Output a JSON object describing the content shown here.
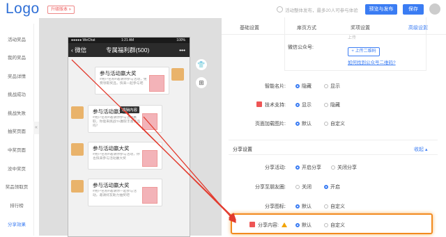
{
  "header": {
    "logo": "Logo",
    "upgrade_label": "升级版本 »",
    "notice": "活动整体发布，最多20人可参与体验",
    "preview_label": "预览与发布",
    "save_label": "保存"
  },
  "sidebar": {
    "items": [
      {
        "label": "活动奖品"
      },
      {
        "label": "我的奖品"
      },
      {
        "label": "奖品详情"
      },
      {
        "label": "挑战成功"
      },
      {
        "label": "挑战失败"
      },
      {
        "label": "抽奖页面"
      },
      {
        "label": "中奖页面"
      },
      {
        "label": "没中奖页"
      },
      {
        "label": "奖品领取页"
      },
      {
        "label": "排行榜"
      },
      {
        "label": "分享效果"
      }
    ],
    "collapse_glyph": "«"
  },
  "phone": {
    "carrier": "●●●●● WeChat",
    "time": "1:21 AM",
    "battery": "100%",
    "back_label": "微信",
    "chat_title": "专属福利群(500)",
    "more": "•••",
    "messages": [
      {
        "title": "参与活动赢大奖",
        "desc": "#用户名称#邀请你参与活动，免费领取奖品，快来一起参与吧"
      },
      {
        "title": "参与活动赢大奖",
        "desc": "#用户名称#邀请你参与活动赢取，你能来挑战TA赢取丰富奖品吗？"
      },
      {
        "title": "参与活动赢大奖",
        "desc": "#用户名称#邀请你参与活动，你也快来参与活动赢大奖"
      },
      {
        "title": "参与活动赢大奖",
        "desc": "#用户名称#邀请你一起参与活动，邀请好友助力抽奖吧"
      }
    ],
    "tooltip": "编辑内容"
  },
  "tools": {
    "shirt_icon": "shirt-icon",
    "grid_icon": "grid-icon"
  },
  "panel": {
    "tabs": [
      "基础设置",
      "扉页方式",
      "奖项设置",
      "高级设置"
    ],
    "active_tab": 3,
    "qr": {
      "upload_hint": "上传",
      "wechat_label": "微信公众号:",
      "upload_button": "+ 上传二维码",
      "help_link": "如何找到公众号二维码?"
    },
    "settings": [
      {
        "label": "智能名片:",
        "options": [
          "隐藏",
          "显示"
        ],
        "selected": 0,
        "icon": false
      },
      {
        "label": "技术支持:",
        "options": [
          "显示",
          "隐藏"
        ],
        "selected": 0,
        "icon": true
      },
      {
        "label": "页面加载图片:",
        "options": [
          "默认",
          "自定义"
        ],
        "selected": 0,
        "icon": false
      }
    ],
    "share_section": {
      "title": "分享设置",
      "collapse": "收起 ▴",
      "rows": [
        {
          "label": "分享活动:",
          "options": [
            "开启分享",
            "关闭分享"
          ],
          "selected": 0
        },
        {
          "label": "分享至朋友圈:",
          "options": [
            "关闭",
            "开启"
          ],
          "selected": 1
        },
        {
          "label": "分享图标:",
          "options": [
            "默认",
            "自定义"
          ],
          "selected": 0
        },
        {
          "label": "分享内容:",
          "options": [
            "默认",
            "自定义"
          ],
          "selected": 0
        }
      ]
    }
  },
  "colors": {
    "accent": "#3a7cf3",
    "highlight": "#f28a1f",
    "arrow": "#e23b2e"
  }
}
